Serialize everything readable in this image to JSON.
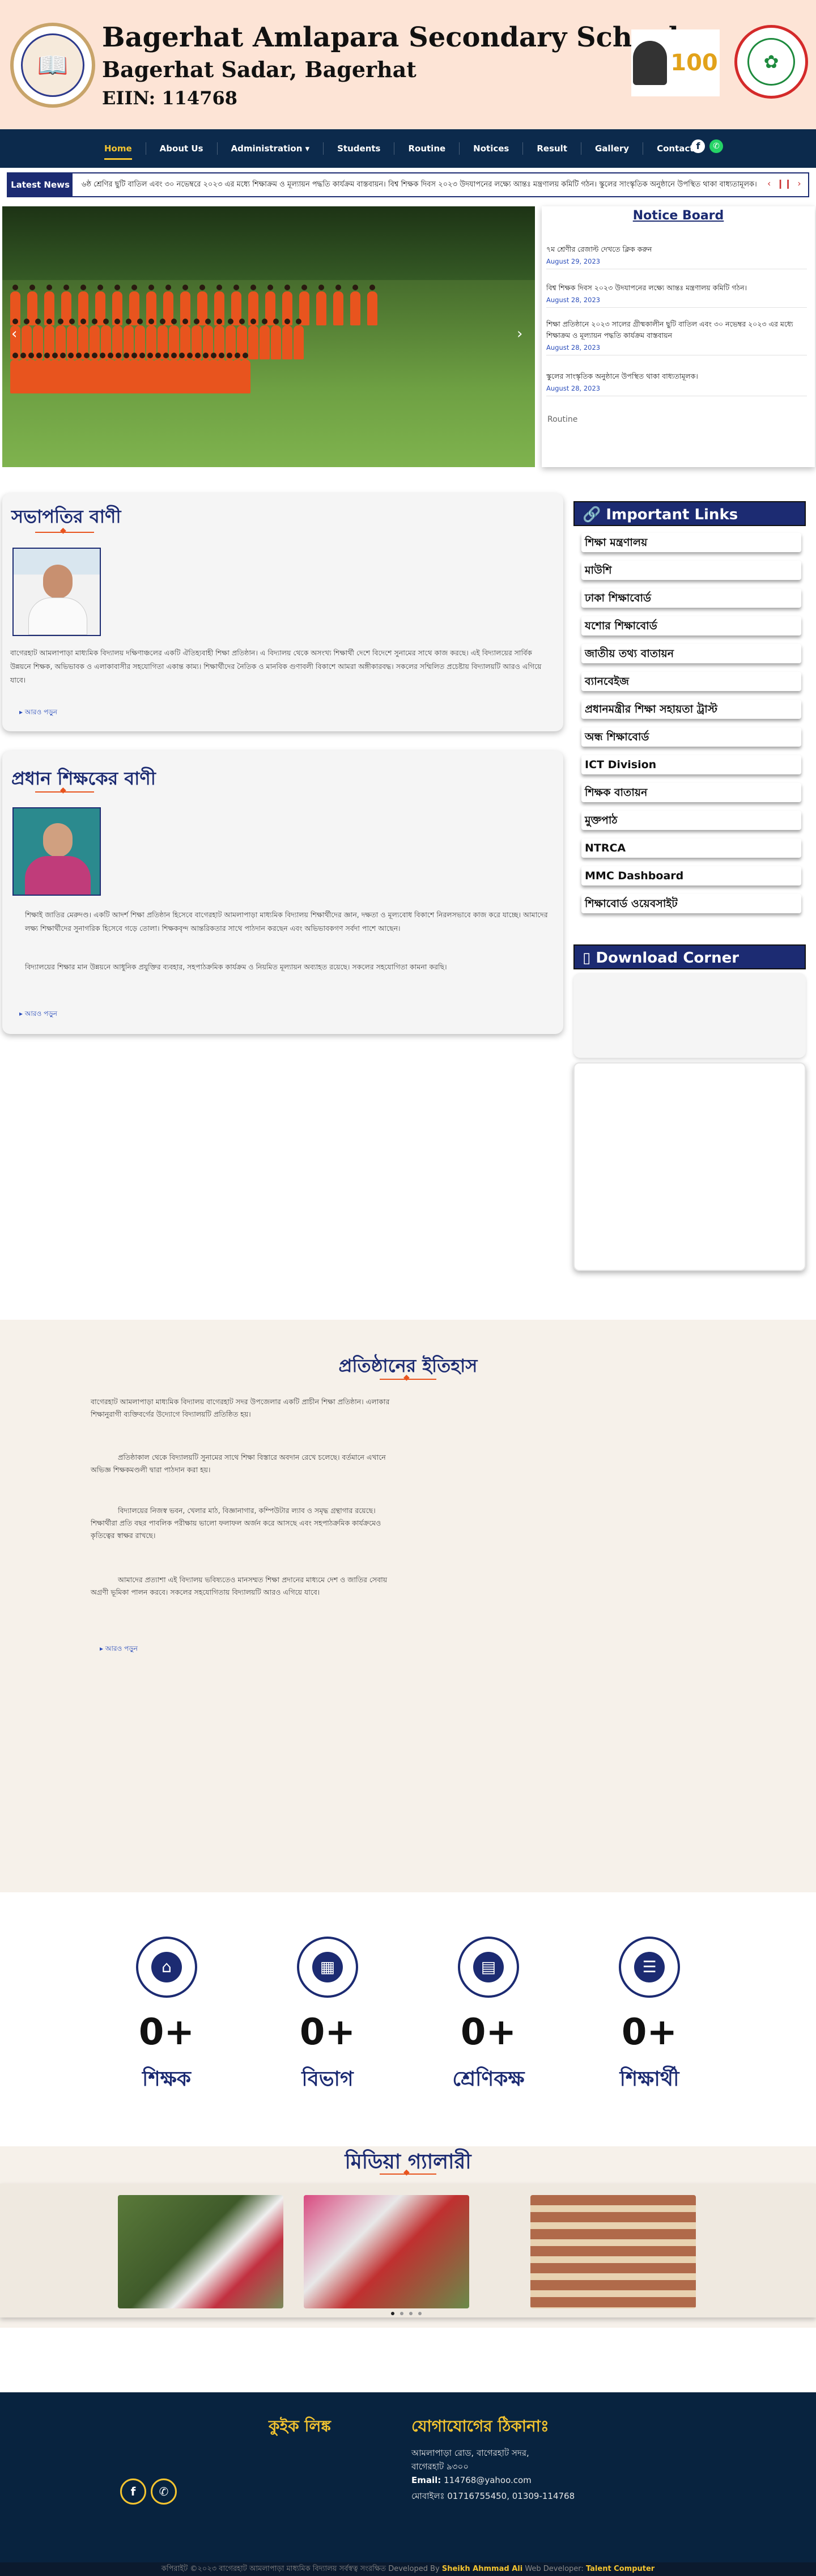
{
  "header": {
    "title": "Bagerhat Amlapara Secondary School",
    "subtitle": "Bagerhat Sadar, Bagerhat",
    "eiin": "EIIN: 114768"
  },
  "nav": {
    "items": [
      "Home",
      "About Us",
      "Administration ▾",
      "Students",
      "Routine",
      "Notices",
      "Result",
      "Gallery",
      "Contact"
    ],
    "active": "Home"
  },
  "ticker": {
    "label": "Latest News",
    "text": "৬ষ্ঠ শ্রেণির ছুটি বাতিল এবং ৩০ নভেম্বরে ২০২৩ এর মধ্যে শিক্ষাক্রম ও মূল্যায়ন পদ্ধতি কার্যক্রম বাস্তবায়ন। বিশ্ব শিক্ষক দিবস ২০২৩ উদযাপনের লক্ষ্যে আন্তঃ মন্ত্রণালয় কমিটি গঠন। স্কুলের সাংস্কৃতিক অনুষ্ঠানে উপস্থিত থাকা বাধ্যতামূলক।"
  },
  "notice_board": {
    "title": "Notice Board",
    "items": [
      {
        "text": "৭ম শ্রেণীর রেজাল্ট দেখতে ক্লিক করুন",
        "date": "August 29, 2023"
      },
      {
        "text": "বিশ্ব শিক্ষক দিবস ২০২৩ উদযাপনের লক্ষ্যে আন্তঃ মন্ত্রণালয় কমিটি গঠন।",
        "date": "August 28, 2023"
      },
      {
        "text": "শিক্ষা প্রতিষ্ঠানে ২০২৩ সালের গ্রীষ্মকালীন ছুটি বাতিল এবং ৩০ নভেম্বর ২০২৩ এর মধ্যে শিক্ষাক্রম ও মূল্যায়ন পদ্ধতি কার্যক্রম বাস্তবায়ন",
        "date": "August 28, 2023"
      },
      {
        "text": "স্কুলের সাংস্কৃতিক অনুষ্ঠানে উপস্থিত থাকা বাধ্যতামূলক।",
        "date": "August 28, 2023"
      }
    ],
    "more": "Routine"
  },
  "president": {
    "title": "সভাপতির বাণী",
    "text": "বাগেরহাট আমলাপাড়া মাধ্যমিক বিদ্যালয় দক্ষিণাঞ্চলের একটি ঐতিহ্যবাহী শিক্ষা প্রতিষ্ঠান। এ বিদ্যালয় থেকে অসংখ্য শিক্ষার্থী দেশে বিদেশে সুনামের সাথে কাজ করছে। এই বিদ্যালয়ের সার্বিক উন্নয়নে শিক্ষক, অভিভাবক ও এলাকাবাসীর সহযোগিতা একান্ত কাম্য। শিক্ষার্থীদের নৈতিক ও মানবিক গুণাবলী বিকাশে আমরা অঙ্গীকারবদ্ধ। সকলের সম্মিলিত প্রচেষ্টায় বিদ্যালয়টি আরও এগিয়ে যাবে।",
    "more": "আরও পড়ুন"
  },
  "headmaster": {
    "title": "প্রধান শিক্ষকের বাণী",
    "text1": "শিক্ষাই জাতির মেরুদণ্ড। একটি আদর্শ শিক্ষা প্রতিষ্ঠান হিসেবে বাগেরহাট আমলাপাড়া মাধ্যমিক বিদ্যালয় শিক্ষার্থীদের জ্ঞান, দক্ষতা ও মূল্যবোধ বিকাশে নিরলসভাবে কাজ করে যাচ্ছে। আমাদের লক্ষ্য শিক্ষার্থীদের সুনাগরিক হিসেবে গড়ে তোলা। শিক্ষকবৃন্দ আন্তরিকতার সাথে পাঠদান করছেন এবং অভিভাবকগণ সর্বদা পাশে আছেন।",
    "text2": "বিদ্যালয়ের শিক্ষার মান উন্নয়নে আধুনিক প্রযুক্তির ব্যবহার, সহপাঠক্রমিক কার্যক্রম ও নিয়মিত মূল্যায়ন অব্যাহত রয়েছে। সকলের সহযোগিতা কামনা করছি।",
    "more": "আরও পড়ুন"
  },
  "important_links": {
    "title": "🔗 Important Links",
    "items": [
      "শিক্ষা মন্ত্রণালয়",
      "মাউশি",
      "ঢাকা শিক্ষাবোর্ড",
      "যশোর শিক্ষাবোর্ড",
      "জাতীয় তথ্য বাতায়ন",
      "ব্যানবেইজ",
      "প্রধানমন্ত্রীর শিক্ষা সহায়তা ট্রাস্ট",
      "অন্ধ শিক্ষাবোর্ড",
      "ICT Division",
      "শিক্ষক বাতায়ন",
      "মুক্তপাঠ",
      "NTRCA",
      "MMC Dashboard",
      "শিক্ষাবোর্ড ওয়েবসাইট"
    ]
  },
  "download": {
    "title": "▯ Download Corner"
  },
  "history": {
    "title": "প্রতিষ্ঠানের ইতিহাস",
    "p1": "বাগেরহাট আমলাপাড়া মাধ্যমিক বিদ্যালয় বাগেরহাট সদর উপজেলার একটি প্রাচীন শিক্ষা প্রতিষ্ঠান। এলাকার শিক্ষানুরাগী ব্যক্তিবর্গের উদ্যোগে বিদ্যালয়টি প্রতিষ্ঠিত হয়।",
    "p2": "প্রতিষ্ঠাকাল থেকে বিদ্যালয়টি সুনামের সাথে শিক্ষা বিস্তারে অবদান রেখে চলেছে। বর্তমানে এখানে অভিজ্ঞ শিক্ষকমণ্ডলী দ্বারা পাঠদান করা হয়।",
    "p3": "বিদ্যালয়ের নিজস্ব ভবন, খেলার মাঠ, বিজ্ঞানাগার, কম্পিউটার ল্যাব ও সমৃদ্ধ গ্রন্থাগার রয়েছে। শিক্ষার্থীরা প্রতি বছর পাবলিক পরীক্ষায় ভালো ফলাফল অর্জন করে আসছে এবং সহপাঠক্রমিক কার্যক্রমেও কৃতিত্বের স্বাক্ষর রাখছে।",
    "p4": "আমাদের প্রত্যাশা এই বিদ্যালয় ভবিষ্যতেও মানসম্মত শিক্ষা প্রদানের মাধ্যমে দেশ ও জাতির সেবায় অগ্রণী ভূমিকা পালন করবে। সকলের সহযোগিতায় বিদ্যালয়টি আরও এগিয়ে যাবে।",
    "more": "আরও পড়ুন"
  },
  "stats": [
    {
      "value": "0+",
      "label": "শিক্ষক",
      "icon": "teacher-icon"
    },
    {
      "value": "0+",
      "label": "বিভাগ",
      "icon": "building-icon"
    },
    {
      "value": "0+",
      "label": "শ্রেণিকক্ষ",
      "icon": "classroom-icon"
    },
    {
      "value": "0+",
      "label": "শিক্ষার্থী",
      "icon": "student-icon"
    }
  ],
  "gallery": {
    "title": "মিডিয়া গ্যালারী"
  },
  "footer": {
    "quick_links": "কুইক লিঙ্ক",
    "contact_title": "যোগাযোগের ঠিকানাঃ",
    "address1": "আমলাপাড়া রোড, বাগেরহাট সদর,",
    "address2": "বাগেরহাট ৯৩০০",
    "email_label": "Email:",
    "email": "114768@yahoo.com",
    "phone_label": "মোবাইলঃ",
    "phone": "01716755450, 01309-114768"
  },
  "copyright": {
    "text": "কপিরাইট ©২০২৩ বাগেরহাট আমলাপাড়া মাধ্যমিক বিদ্যালয় সর্বস্বত্ব সংরক্ষিত",
    "dev_label": "Developed By",
    "developer": "Sheikh Ahmmad Ali",
    "web_label": "Web Developer:",
    "company": "Talent Computer"
  }
}
